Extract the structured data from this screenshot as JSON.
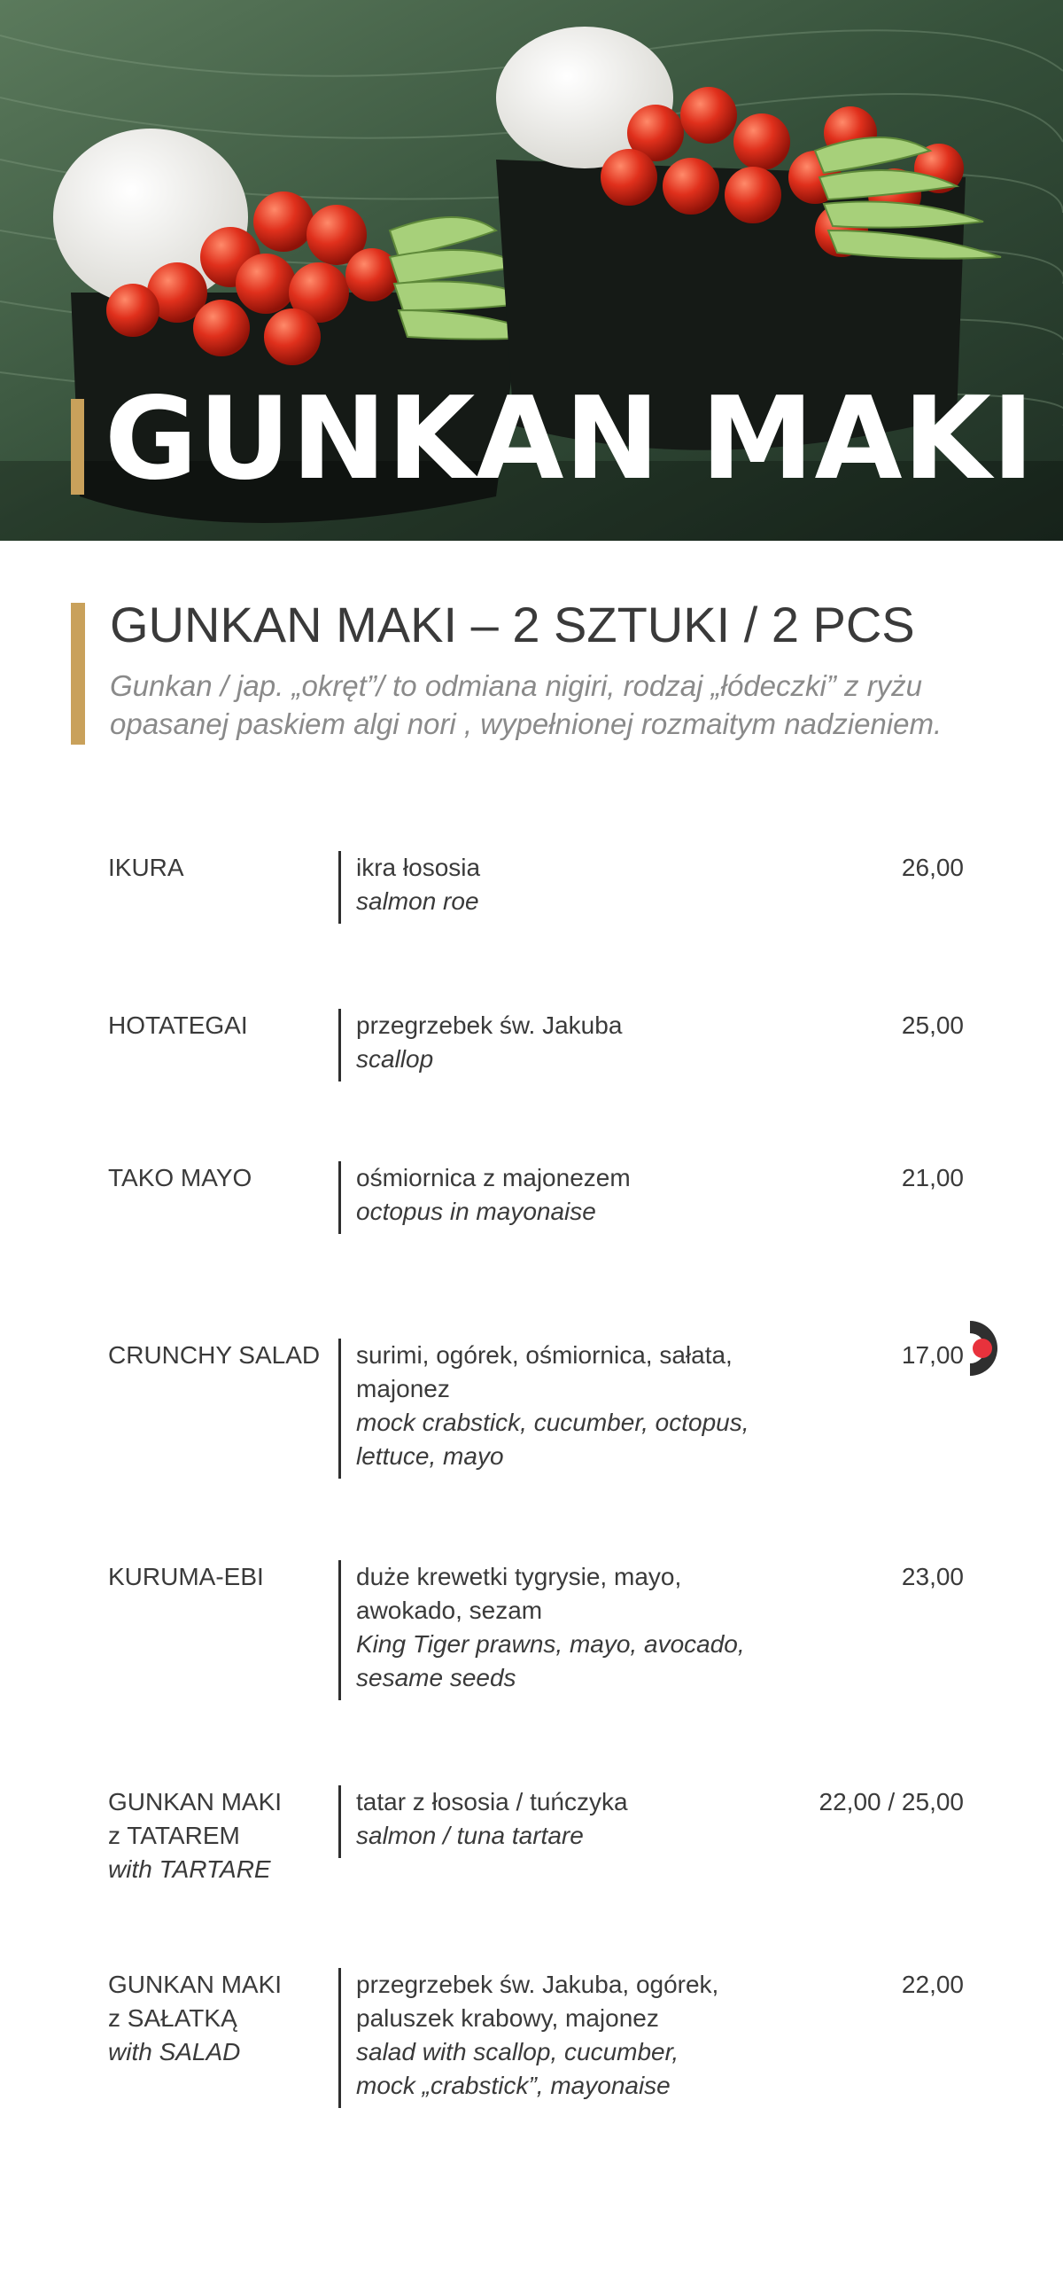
{
  "hero": {
    "title": "GUNKAN MAKI"
  },
  "section": {
    "title": "GUNKAN MAKI – 2  SZTUKI / 2 PCS",
    "description": "Gunkan / jap. „okręt”/ to odmiana nigiri, rodzaj „łódeczki” z ryżu opasanej paskiem algi nori , wypełnionej rozmaitym nadzieniem."
  },
  "colors": {
    "accent": "#c9a15b",
    "text": "#3a3a3a",
    "muted": "#8a8a8a",
    "marker_red": "#e8323c"
  },
  "items": [
    {
      "name": [
        "IKURA"
      ],
      "name_en": "",
      "desc_pl": [
        "ikra łososia"
      ],
      "desc_en": [
        "salmon roe"
      ],
      "price": "26,00"
    },
    {
      "name": [
        "HOTATEGAI"
      ],
      "name_en": "",
      "desc_pl": [
        "przegrzebek św. Jakuba"
      ],
      "desc_en": [
        "scallop"
      ],
      "price": "25,00"
    },
    {
      "name": [
        "TAKO MAYO"
      ],
      "name_en": "",
      "desc_pl": [
        "ośmiornica z majonezem"
      ],
      "desc_en": [
        "octopus in mayonaise"
      ],
      "price": "21,00"
    },
    {
      "name": [
        "CRUNCHY SALAD"
      ],
      "name_en": "",
      "desc_pl": [
        "surimi, ogórek, ośmiornica, sałata,",
        "majonez"
      ],
      "desc_en": [
        "mock crabstick, cucumber, octopus,",
        "lettuce, mayo"
      ],
      "price": "17,00",
      "marker_icon": "spicy-marker-icon"
    },
    {
      "name": [
        "KURUMA-EBI"
      ],
      "name_en": "",
      "desc_pl": [
        "duże krewetki tygrysie, mayo,",
        "awokado, sezam"
      ],
      "desc_en": [
        "King Tiger prawns, mayo, avocado,",
        "sesame seeds"
      ],
      "price": "23,00"
    },
    {
      "name": [
        "GUNKAN MAKI",
        "z TATAREM"
      ],
      "name_en": "with TARTARE",
      "desc_pl": [
        "tatar z łososia / tuńczyka"
      ],
      "desc_en": [
        "salmon / tuna tartare"
      ],
      "price": "22,00 / 25,00"
    },
    {
      "name": [
        "GUNKAN MAKI",
        "z SAŁATKĄ"
      ],
      "name_en": "with SALAD",
      "desc_pl": [
        "przegrzebek św. Jakuba, ogórek,",
        "paluszek krabowy, majonez"
      ],
      "desc_en": [
        "salad with scallop, cucumber,",
        "mock „crabstick”, mayonaise"
      ],
      "price": "22,00"
    }
  ]
}
